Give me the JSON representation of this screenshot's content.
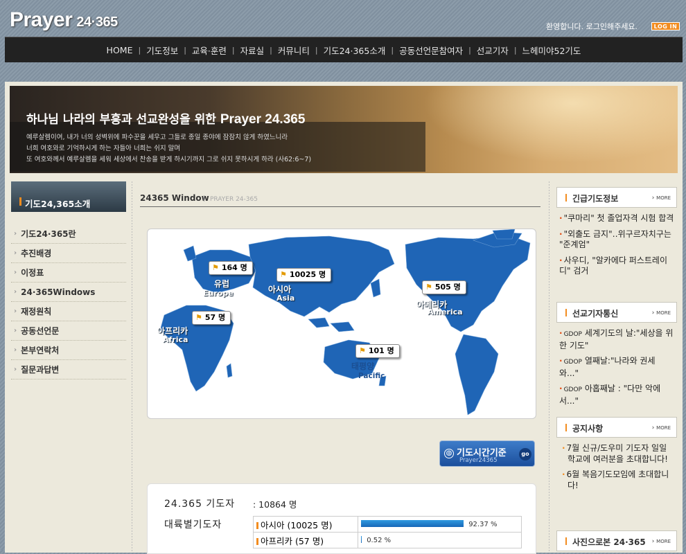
{
  "header": {
    "logo_text": "Prayer",
    "logo_num": "24·365",
    "welcome": "환영합니다. 로그인해주세요.",
    "login_label": "LOG IN"
  },
  "topnav": [
    "HOME",
    "기도정보",
    "교육·훈련",
    "자료실",
    "커뮤니티",
    "기도24·365소개",
    "공동선언문참여자",
    "선교기자",
    "느헤미야52기도"
  ],
  "banner": {
    "title_ko": "하나님 나라의 부흥과 선교완성을 위한",
    "title_en": "Prayer 24.365",
    "verse": [
      "예루살렘이여, 내가 너의 성벽위에 파수꾼을 세우고 그들로 종일 종야에 잠잠치 않게 하였느니라",
      "너희 여호와로 기억하시게 하는 자들아 너희는 쉬지 말며",
      "또 여호와께서 예루살렘을 세워 세상에서 찬송을 받게 하시기까지 그로 쉬지 못하시게 하라 (사62:6~7)"
    ]
  },
  "left": {
    "header": "기도24,365소개",
    "menu": [
      "기도24·365란",
      "추진배경",
      "이정표",
      "24·365Windows",
      "재정원칙",
      "공동선언문",
      "본부연락처",
      "질문과답변"
    ]
  },
  "center": {
    "title": "24365 Window",
    "subtitle": "PRAYER 24-365",
    "map": {
      "europe": {
        "count": "164 명",
        "ko": "유럽",
        "en": "Europe"
      },
      "asia": {
        "count": "10025 명",
        "ko": "아시아",
        "en": "Asia"
      },
      "africa": {
        "count": "57 명",
        "ko": "아프리카",
        "en": "Africa"
      },
      "america": {
        "count": "505 명",
        "ko": "아메리카",
        "en": "America"
      },
      "pacific": {
        "count": "101 명",
        "ko": "태평양",
        "en": "Pacific"
      }
    },
    "time_button": {
      "label": "기도시간기준",
      "sub": "Prayer24365",
      "go": "go"
    },
    "stats": {
      "total_label": "24.365 기도자",
      "total_value": ": 10864 명",
      "by_continent_label": "대륙별기도자",
      "rows": [
        {
          "name": "아시아 (10025 명)",
          "percent": "92.37 %",
          "fraction": 0.9237
        },
        {
          "name": "아프리카 (57 명)",
          "percent": "0.52 %",
          "fraction": 0.0052
        }
      ]
    }
  },
  "right": {
    "urgent": {
      "title": "긴급기도정보",
      "more": "MORE",
      "items": [
        "\"쿠마리\" 첫 졸업자격 시험 합격",
        "\"외출도 금지\"‥위구르자치구는 \"준계엄\"",
        "사우디, \"알카에다 퍼스트레이디\" 검거"
      ]
    },
    "missionary": {
      "title": "선교기자통신",
      "more": "MORE",
      "items": [
        {
          "tag": "GDOP",
          "text": "세계기도의 날:\"세상을 위한 기도\""
        },
        {
          "tag": "GDOP",
          "text": "열째날:\"나라와 권세와...\""
        },
        {
          "tag": "GDOP",
          "text": "아홉째날 : \"다만 악에서...\""
        }
      ]
    },
    "notice": {
      "title": "공지사항",
      "more": "MORE",
      "items": [
        "7월 신규/도우미 기도자 일일학교에 여러분을 초대합니다!",
        "6월 복음기도모임에 초대합니다!"
      ]
    },
    "photo": {
      "title": "사진으로본 24·365",
      "more": "MORE"
    }
  },
  "colors": {
    "accent": "#f28c1f",
    "map_blue": "#1f65b6",
    "nav_bg": "#222222"
  }
}
